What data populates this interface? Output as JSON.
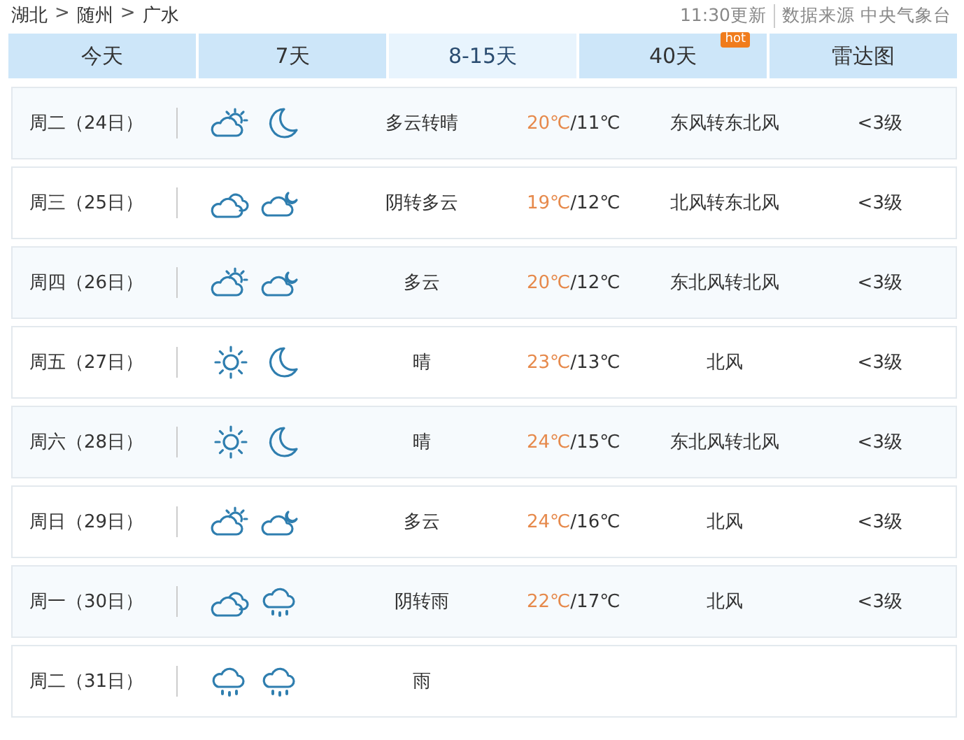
{
  "breadcrumb": [
    {
      "kind": "link",
      "label": "湖北"
    },
    {
      "kind": "separator",
      "label": ">"
    },
    {
      "kind": "link",
      "label": "随州"
    },
    {
      "kind": "separator",
      "label": ">"
    },
    {
      "kind": "link",
      "label": "广水"
    }
  ],
  "update_time": "11:30更新",
  "source": "数据来源 中央气象台",
  "tabs": [
    {
      "label": "今天",
      "selected": false
    },
    {
      "label": "7天",
      "selected": false
    },
    {
      "label": "8-15天",
      "selected": true
    },
    {
      "label": "40天",
      "selected": false,
      "badge": "hot"
    },
    {
      "label": "雷达图",
      "selected": false
    }
  ],
  "days": [
    {
      "date": "周二（24日）",
      "icons": [
        {
          "kind": "partly-sunny"
        },
        {
          "kind": "moon"
        }
      ],
      "weather": "多云转晴",
      "high": "20℃",
      "low": "/11℃",
      "wind": "东风转东北风",
      "level": "<3级"
    },
    {
      "date": "周三（25日）",
      "icons": [
        {
          "kind": "cloudy"
        },
        {
          "kind": "partly-night"
        }
      ],
      "weather": "阴转多云",
      "high": "19℃",
      "low": "/12℃",
      "wind": "北风转东北风",
      "level": "<3级"
    },
    {
      "date": "周四（26日）",
      "icons": [
        {
          "kind": "partly-sunny"
        },
        {
          "kind": "partly-night"
        }
      ],
      "weather": "多云",
      "high": "20℃",
      "low": "/12℃",
      "wind": "东北风转北风",
      "level": "<3级"
    },
    {
      "date": "周五（27日）",
      "icons": [
        {
          "kind": "sunny"
        },
        {
          "kind": "moon"
        }
      ],
      "weather": "晴",
      "high": "23℃",
      "low": "/13℃",
      "wind": "北风",
      "level": "<3级"
    },
    {
      "date": "周六（28日）",
      "icons": [
        {
          "kind": "sunny"
        },
        {
          "kind": "moon"
        }
      ],
      "weather": "晴",
      "high": "24℃",
      "low": "/15℃",
      "wind": "东北风转北风",
      "level": "<3级"
    },
    {
      "date": "周日（29日）",
      "icons": [
        {
          "kind": "partly-sunny"
        },
        {
          "kind": "partly-night"
        }
      ],
      "weather": "多云",
      "high": "24℃",
      "low": "/16℃",
      "wind": "北风",
      "level": "<3级"
    },
    {
      "date": "周一（30日）",
      "icons": [
        {
          "kind": "cloudy"
        },
        {
          "kind": "rain"
        }
      ],
      "weather": "阴转雨",
      "high": "22℃",
      "low": "/17℃",
      "wind": "北风",
      "level": "<3级"
    },
    {
      "date": "周二（31日）",
      "icons": [
        {
          "kind": "rain"
        },
        {
          "kind": "rain"
        }
      ],
      "weather": "雨"
    }
  ]
}
